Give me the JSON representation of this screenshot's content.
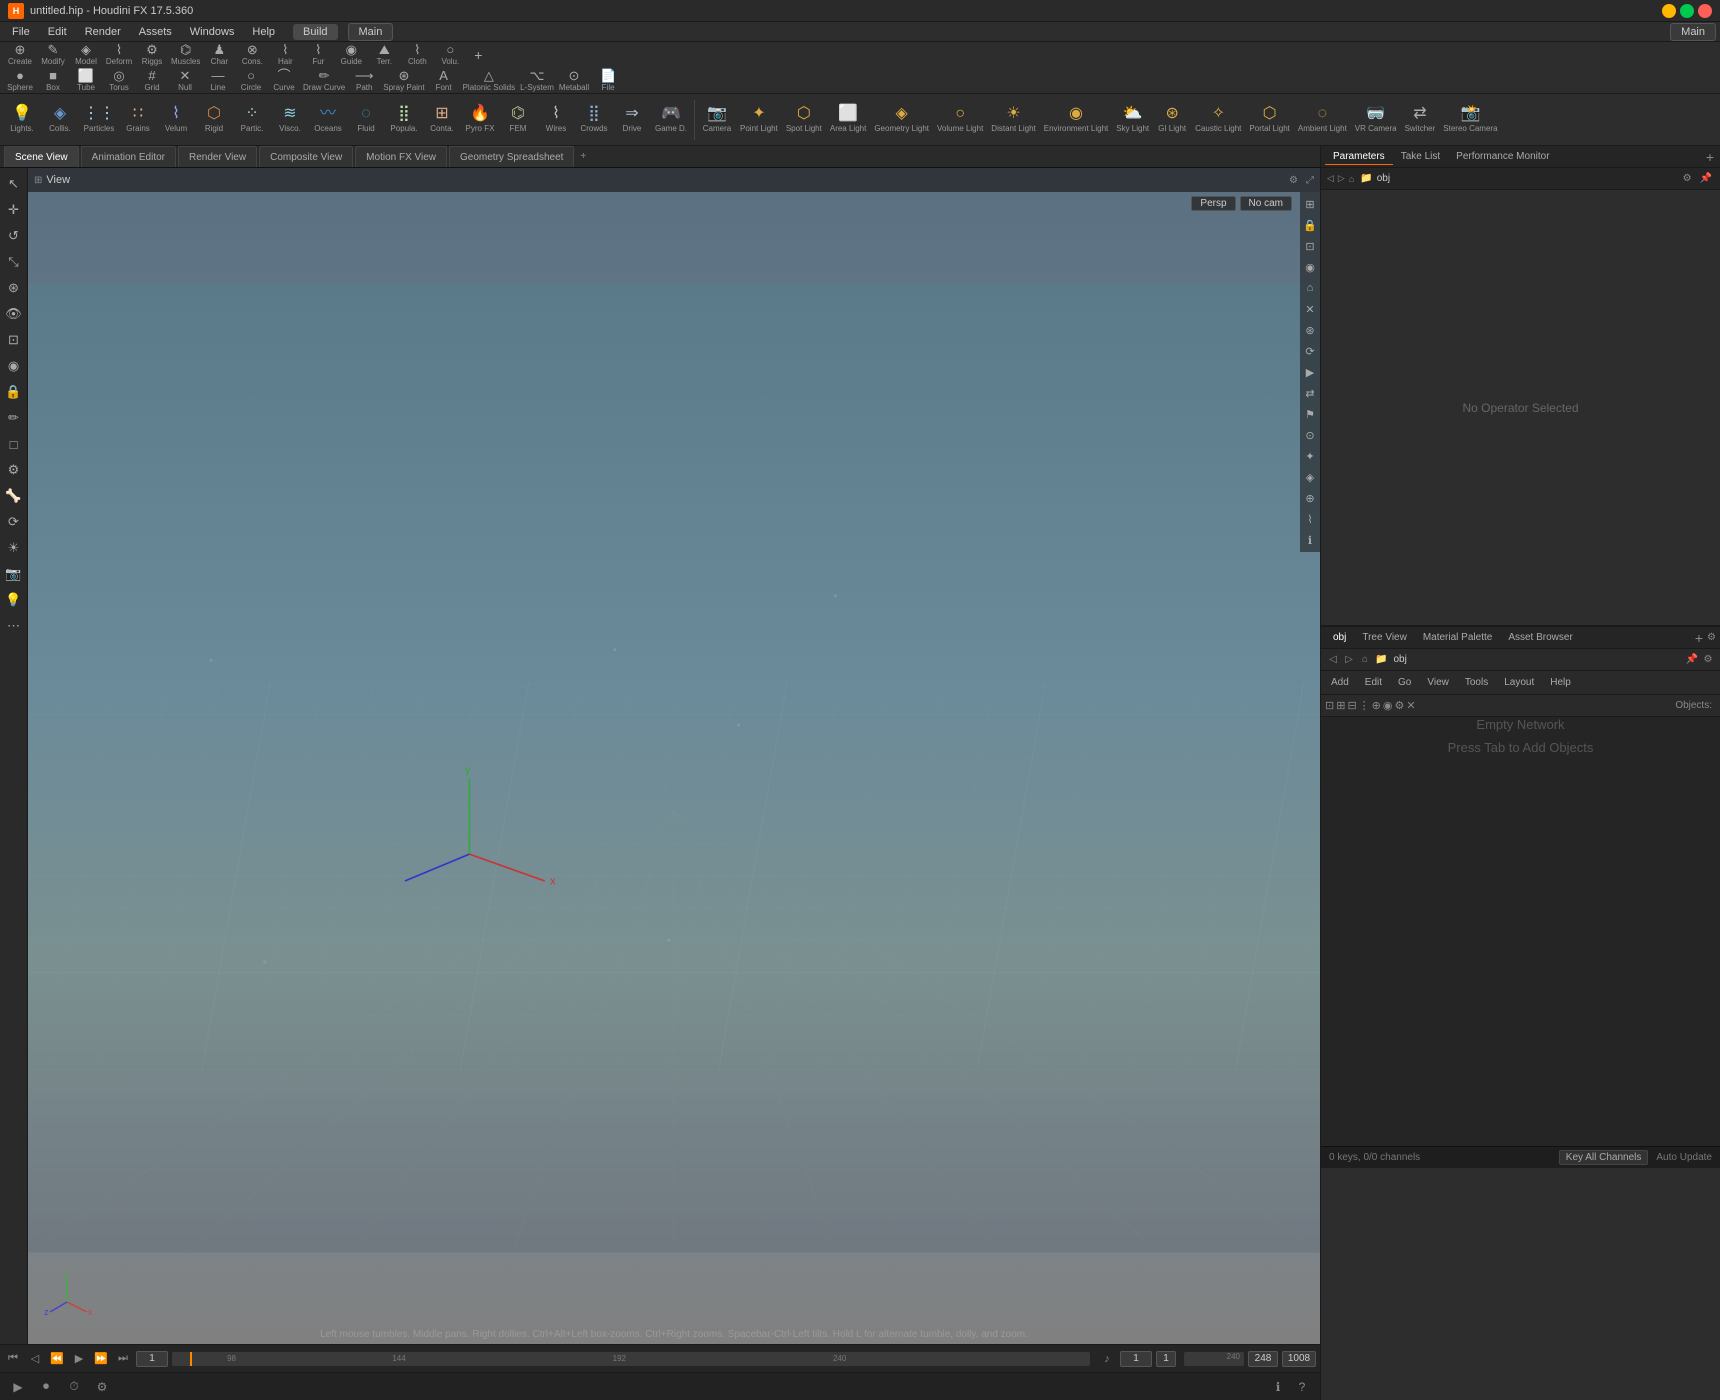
{
  "app": {
    "title": "untitled.hip - Houdini FX 17.5.360",
    "status": "No Operator Selected",
    "network_empty": "Empty Network",
    "network_hint": "Press Tab to Add Objects",
    "objects_label": "Objects:"
  },
  "title_bar": {
    "title": "untitled.hip - Houdini FX 17.5.360"
  },
  "menu": {
    "items": [
      "File",
      "Edit",
      "Render",
      "Assets",
      "Windows",
      "Help"
    ],
    "build_label": "Build",
    "desktop_label": "Main",
    "right_label": "Main"
  },
  "toolbar_row1": {
    "create_label": "Create",
    "modify_label": "Modify",
    "model_label": "Model",
    "deform_label": "Deform",
    "riggs_label": "Riggs",
    "muscles_label": "Muscles",
    "char_label": "Char",
    "cons_label": "Cons.",
    "hair_label": "Hair",
    "fur_label": "Fur",
    "guide_label": "Guide",
    "terr_label": "Terr.",
    "cloth_label": "Cloth",
    "volu_label": "Volu.",
    "new_label": "New"
  },
  "toolbar_row2": {
    "sphere_label": "Sphere",
    "box_label": "Box",
    "tube_label": "Tube",
    "torus_label": "Torus",
    "grid_label": "Grid",
    "null_label": "Null",
    "line_label": "Line",
    "circle_label": "Circle",
    "curve_label": "Curve",
    "draw_curve_label": "Draw Curve",
    "path_label": "Path",
    "spray_paint_label": "Spray Paint",
    "font_label": "Font",
    "platonic_solids_label": "Platonic Solids",
    "l_system_label": "L-System",
    "metaball_label": "Metaball",
    "file_label": "File"
  },
  "lights_toolbar": {
    "lights_label": "Lights.",
    "collis_label": "Collis.",
    "particles_label": "Particles",
    "grains_label": "Grains",
    "velum_label": "Velum",
    "rigid_label": "Rigid",
    "partic_label": "Partic.",
    "visco_label": "Visco.",
    "oceans_label": "Oceans",
    "fluid_label": "Fluid",
    "popula_label": "Popula.",
    "conta_label": "Conta.",
    "pyro_fx_label": "Pyro FX",
    "fem_label": "FEM",
    "wires_label": "Wires",
    "crowds_label": "Crowds",
    "drive_label": "Drive",
    "game_d_label": "Game D.",
    "camera_label": "Camera",
    "point_light_label": "Point Light",
    "spot_light_label": "Spot Light",
    "area_light_label": "Area Light",
    "geometry_light_label": "Geometry Light",
    "volume_light_label": "Volume Light",
    "distant_light_label": "Distant Light",
    "environment_light_label": "Environment Light",
    "sky_light_label": "Sky Light",
    "gi_light_label": "GI Light",
    "caustic_light_label": "Caustic Light",
    "portal_light_label": "Portal Light",
    "ambient_light_label": "Ambient Light",
    "vr_camera_label": "VR Camera",
    "switcher_label": "Switcher",
    "stereo_camera_label": "Stereo Camera"
  },
  "viewport_tabs": [
    {
      "label": "Scene View",
      "active": true
    },
    {
      "label": "Animation Editor",
      "active": false
    },
    {
      "label": "Render View",
      "active": false
    },
    {
      "label": "Composite View",
      "active": false
    },
    {
      "label": "Motion FX View",
      "active": false
    },
    {
      "label": "Geometry Spreadsheet",
      "active": false
    }
  ],
  "viewport": {
    "view_type": "Persp",
    "camera": "No cam",
    "label": "View",
    "status_text": "Left mouse tumbles. Middle pans. Right dollies. Ctrl+Alt+Left box-zooms. Ctrl+Right zooms. Spacebar-Ctrl-Left tilts. Hold L for alternate tumble, dolly, and zoom.",
    "path": "obj"
  },
  "right_panel": {
    "tabs": [
      "Parameters",
      "Take List",
      "Performance Monitor"
    ],
    "active_tab": "Parameters",
    "path": "obj",
    "status": "No Operator Selected"
  },
  "network_panel": {
    "tabs": [
      "obj",
      "Tree View",
      "Material Palette",
      "Asset Browser"
    ],
    "active_tab": "obj",
    "path": "obj",
    "menu_items": [
      "Add",
      "Edit",
      "Go",
      "View",
      "Tools",
      "Layout",
      "Help"
    ],
    "empty_text": "Empty Network",
    "hint_text": "Press Tab to Add Objects",
    "objects_label": "Objects:"
  },
  "timeline": {
    "frame": "1",
    "start_frame": "1",
    "end_frame": "240",
    "current": "248",
    "markers": [
      "98",
      "144",
      "192",
      "240"
    ],
    "key_label": "0 keys, 0/0 channels",
    "key_all_label": "Key All Channels",
    "auto_update_label": "Auto Update"
  },
  "bottom_bar": {
    "status": "",
    "frame_rate": ""
  }
}
